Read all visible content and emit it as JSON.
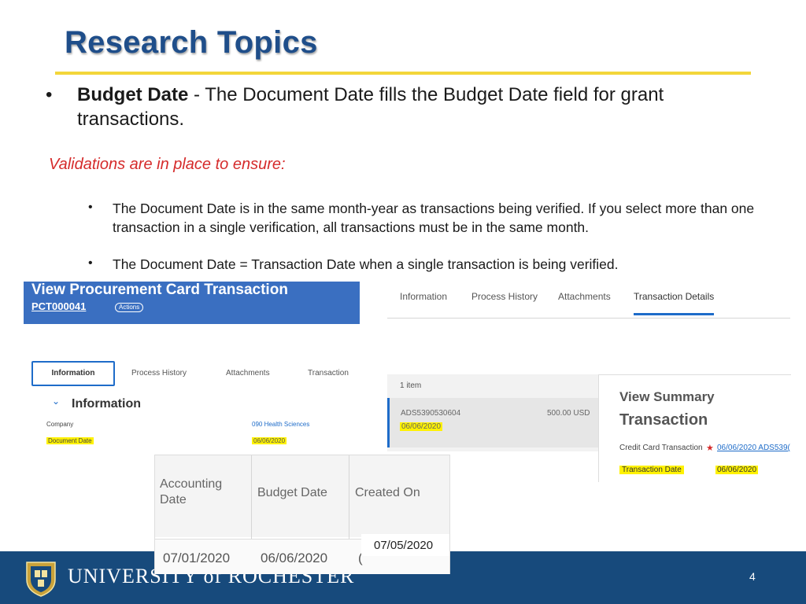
{
  "slide": {
    "title": "Research Topics",
    "bullet1_term": "Budget Date",
    "bullet1_text": " - The Document Date fills the Budget Date field for grant transactions.",
    "validations": "Validations are in place to ensure:",
    "sub_bullets": [
      "The Document Date is in the same month-year as transactions being verified.  If you select more than one transaction in a single verification, all transactions must be in the same month.",
      "The Document Date = Transaction Date when a single transaction is being verified."
    ],
    "page_number": "4",
    "footer_text": "UNIVERSITY of ROCHESTER",
    "bullet_glyph": "•"
  },
  "pc_header": {
    "title": "View Procurement Card Transaction",
    "id": "PCT000041",
    "actions": "Actions"
  },
  "tabs_right": [
    "Information",
    "Process History",
    "Attachments",
    "Transaction Details"
  ],
  "tabs_left": [
    "Information",
    "Process History",
    "Attachments",
    "Transaction"
  ],
  "info_section": {
    "heading": "Information",
    "company_label": "Company",
    "company_value": "090 Health Sciences",
    "docdate_label": "Document Date",
    "docdate_value": "06/06/2020"
  },
  "items": {
    "count": "1 item",
    "id": "ADS5390530604",
    "amount": "500.00 USD",
    "date": "06/06/2020"
  },
  "summary": {
    "heading1": "View Summary",
    "heading2": "Transaction",
    "cc_label": "Credit Card Transaction",
    "cc_value": "06/06/2020 ADS539(",
    "td_label": "Transaction Date",
    "td_value": "06/06/2020"
  },
  "table": {
    "headers": [
      "Accounting Date",
      "Budget Date",
      "Created On"
    ],
    "row": [
      "07/01/2020",
      "06/06/2020",
      "("
    ],
    "created_on": "07/05/2020"
  },
  "colors": {
    "title": "#1f4e8a",
    "accent_rule": "#f3d63a",
    "validation_red": "#d52b2b",
    "footer_blue": "#174a7c",
    "link_blue": "#1e6cc9",
    "highlight": "#fff200"
  }
}
